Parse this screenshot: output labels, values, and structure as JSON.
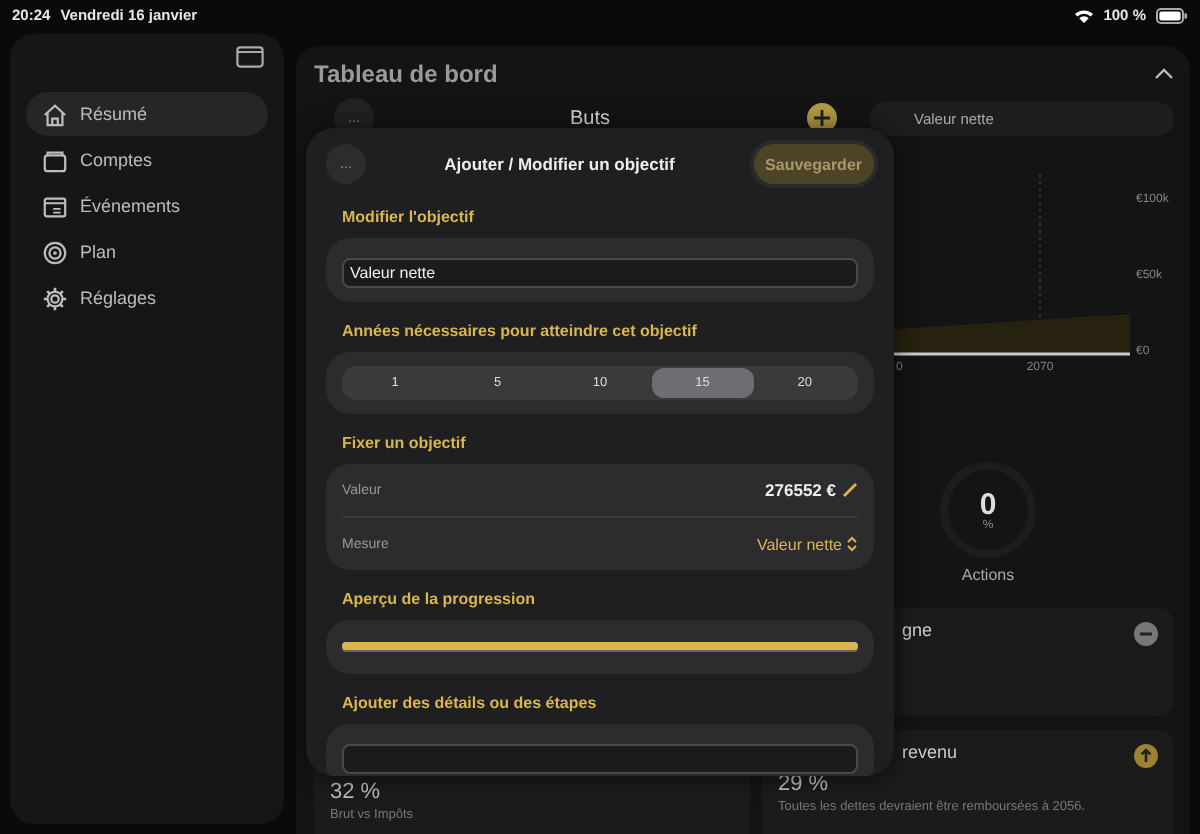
{
  "status_bar": {
    "time": "20:24",
    "date": "Vendredi 16 janvier",
    "battery": "100 %"
  },
  "sidebar": {
    "items": [
      {
        "label": "Résumé",
        "kind": "home",
        "selected": true
      },
      {
        "label": "Comptes",
        "kind": "wallet",
        "selected": false
      },
      {
        "label": "Événements",
        "kind": "calendar",
        "selected": false
      },
      {
        "label": "Plan",
        "kind": "target",
        "selected": false
      },
      {
        "label": "Réglages",
        "kind": "gear",
        "selected": false
      }
    ]
  },
  "dashboard": {
    "title": "Tableau de bord",
    "goals": {
      "more": "...",
      "title": "Buts"
    },
    "filter": "Valeur nette",
    "chart": {
      "y_labels": [
        "€100k",
        "€50k",
        "€0"
      ],
      "x_labels": [
        "0",
        "2070"
      ]
    },
    "gauge": {
      "value": "0",
      "unit": "%",
      "label": "Actions"
    },
    "left_card": {
      "value": "32 %",
      "note": "Brut vs Impôts"
    },
    "cards": [
      {
        "kind": "minus",
        "title": "gne"
      },
      {
        "kind": "up",
        "title": "revenu",
        "value": "29 %",
        "note": "Toutes les dettes devraient être remboursées à 2056."
      }
    ]
  },
  "modal": {
    "more": "...",
    "title": "Ajouter / Modifier un objectif",
    "save": {
      "label": "Sauvegarder",
      "disabled": true
    },
    "sections": [
      {
        "kind": "field",
        "heading": "Modifier l'objectif",
        "value": "Valeur nette"
      },
      {
        "kind": "segments",
        "heading": "Années nécessaires pour atteindre cet objectif",
        "options": [
          {
            "label": "1",
            "selected": false
          },
          {
            "label": "5",
            "selected": false
          },
          {
            "label": "10",
            "selected": false
          },
          {
            "label": "15",
            "selected": true
          },
          {
            "label": "20",
            "selected": false
          }
        ]
      },
      {
        "kind": "rows",
        "heading": "Fixer un objectif",
        "rows": [
          {
            "kind": "edit",
            "label": "Valeur",
            "value": "276552 €"
          },
          {
            "kind": "picker",
            "label": "Mesure",
            "value": "Valeur nette"
          }
        ]
      },
      {
        "kind": "progress",
        "heading": "Aperçu de la progression",
        "level": 1
      },
      {
        "kind": "field",
        "heading": "Ajouter des détails ou des étapes"
      }
    ]
  }
}
